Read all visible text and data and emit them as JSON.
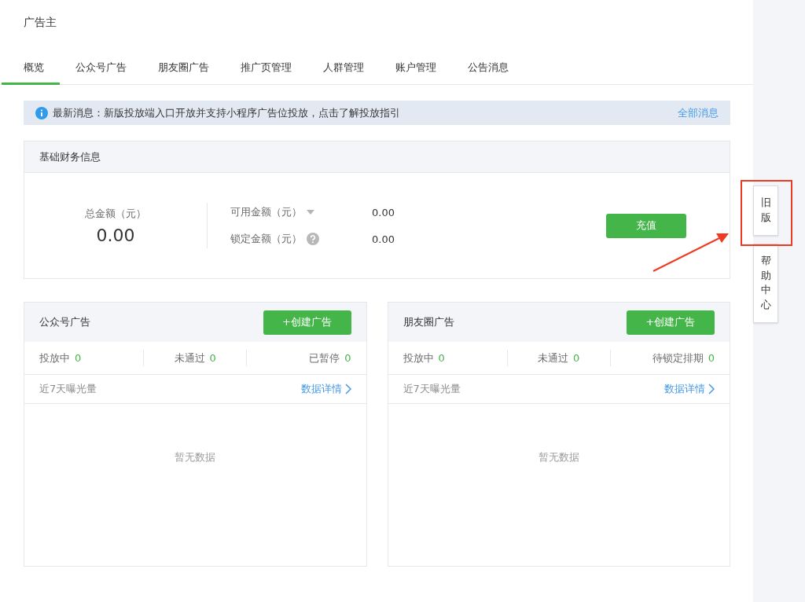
{
  "header": {
    "title": "广告主"
  },
  "tabs": [
    {
      "label": "概览",
      "selected": true
    },
    {
      "label": "公众号广告",
      "selected": false
    },
    {
      "label": "朋友圈广告",
      "selected": false
    },
    {
      "label": "推广页管理",
      "selected": false
    },
    {
      "label": "人群管理",
      "selected": false
    },
    {
      "label": "账户管理",
      "selected": false
    },
    {
      "label": "公告消息",
      "selected": false
    }
  ],
  "notice": {
    "text": "最新消息：新版投放端入口开放并支持小程序广告位投放，点击了解投放指引",
    "link": "全部消息"
  },
  "finance": {
    "title": "基础财务信息",
    "total_label": "总金额（元）",
    "total_value": "0.00",
    "button": "充值",
    "rows": [
      {
        "label": "可用金额（元）",
        "kind": "dropdown",
        "value": "0.00"
      },
      {
        "label": "锁定金额（元）",
        "kind": "help",
        "value": "0.00"
      }
    ]
  },
  "ad_panels": [
    {
      "title": "公众号广告",
      "button": "+创建广告",
      "stats": [
        {
          "label": "投放中",
          "value": "0"
        },
        {
          "label": "未通过",
          "value": "0"
        },
        {
          "label": "已暂停",
          "value": "0"
        }
      ],
      "exposure_label": "近7天曝光量",
      "details_link": "数据详情",
      "empty_text": "暂无数据"
    },
    {
      "title": "朋友圈广告",
      "button": "+创建广告",
      "stats": [
        {
          "label": "投放中",
          "value": "0"
        },
        {
          "label": "未通过",
          "value": "0"
        },
        {
          "label": "待锁定排期",
          "value": "0"
        }
      ],
      "exposure_label": "近7天曝光量",
      "details_link": "数据详情",
      "empty_text": "暂无数据"
    }
  ],
  "side_tabs": [
    {
      "label": "旧版"
    },
    {
      "label": "帮助中心"
    }
  ]
}
